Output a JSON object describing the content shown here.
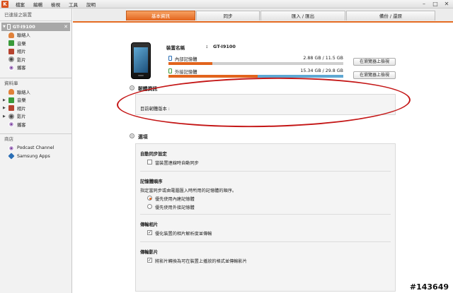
{
  "app": {
    "logo_text": "K",
    "menu": [
      "檔案",
      "編輯",
      "檢視",
      "工具",
      "說明"
    ],
    "window_controls": [
      "–",
      "□",
      "✕"
    ]
  },
  "sidebar": {
    "connected_header": "已連接之裝置",
    "device": {
      "name": "GT-I9100",
      "close": "✕"
    },
    "device_items": [
      {
        "label": "聯絡人",
        "icon": "contacts-icon"
      },
      {
        "label": "音樂",
        "icon": "music-icon"
      },
      {
        "label": "相片",
        "icon": "photo-icon"
      },
      {
        "label": "影片",
        "icon": "video-icon"
      },
      {
        "label": "播客",
        "icon": "podcast-icon"
      }
    ],
    "library_header": "資料庫",
    "library_items": [
      {
        "label": "聯絡人",
        "icon": "contacts-icon",
        "expandable": false
      },
      {
        "label": "音樂",
        "icon": "music-icon",
        "expandable": true
      },
      {
        "label": "相片",
        "icon": "photo-icon",
        "expandable": true
      },
      {
        "label": "影片",
        "icon": "video-icon",
        "expandable": true
      },
      {
        "label": "播客",
        "icon": "podcast-icon",
        "expandable": false
      }
    ],
    "store_header": "商店",
    "store_items": [
      {
        "label": "Podcast Channel",
        "icon": "podcast-icon"
      },
      {
        "label": "Samsung Apps",
        "icon": "samsung-apps-icon"
      }
    ]
  },
  "tabs": [
    {
      "label": "基本資訊",
      "active": true
    },
    {
      "label": "同步",
      "active": false
    },
    {
      "label": "匯入 / 匯出",
      "active": false
    },
    {
      "label": "備份 / 還原",
      "active": false
    }
  ],
  "device_info": {
    "name_label": "裝置名稱",
    "colon": ":",
    "name_value": "GT-I9100",
    "internal": {
      "label": "內部記憶體",
      "usage": "2.88 GB / 11.5 GB",
      "fraction": 0.25,
      "fraction_other": 0.0
    },
    "external": {
      "label": "外接記憶體",
      "usage": "15.34 GB / 29.8 GB",
      "fraction": 0.51,
      "fraction_other": 0.49
    },
    "browse_label": "在瀏覽器上檢視"
  },
  "firmware": {
    "title": "韌體資訊",
    "current_label": "目前韌體版本 :"
  },
  "options": {
    "title": "選項",
    "auto_sync": {
      "heading": "自動同步設定",
      "checkbox_label": "當裝置連線時自動同步",
      "checked": false
    },
    "memory_order": {
      "heading": "記憶體順序",
      "description": "指定當同步或由電腦匯入時所用的記憶體的順序。",
      "radio_internal": "優先使用內建記憶體",
      "radio_external": "優先使用外接記憶體",
      "selected": "internal"
    },
    "transfer_photos": {
      "heading": "傳輸相片",
      "checkbox_label": "優化裝置的相片解析度並傳輸",
      "checked": true
    },
    "transfer_videos": {
      "heading": "傳輸影片",
      "checkbox_label": "將影片轉換為可在裝置上播放的格式並傳輸影片",
      "checked": true
    }
  },
  "watermark": "#143649",
  "colors": {
    "accent": "#e2641d",
    "annotation": "#c41616",
    "secondary_bar": "#5fa8d3"
  }
}
